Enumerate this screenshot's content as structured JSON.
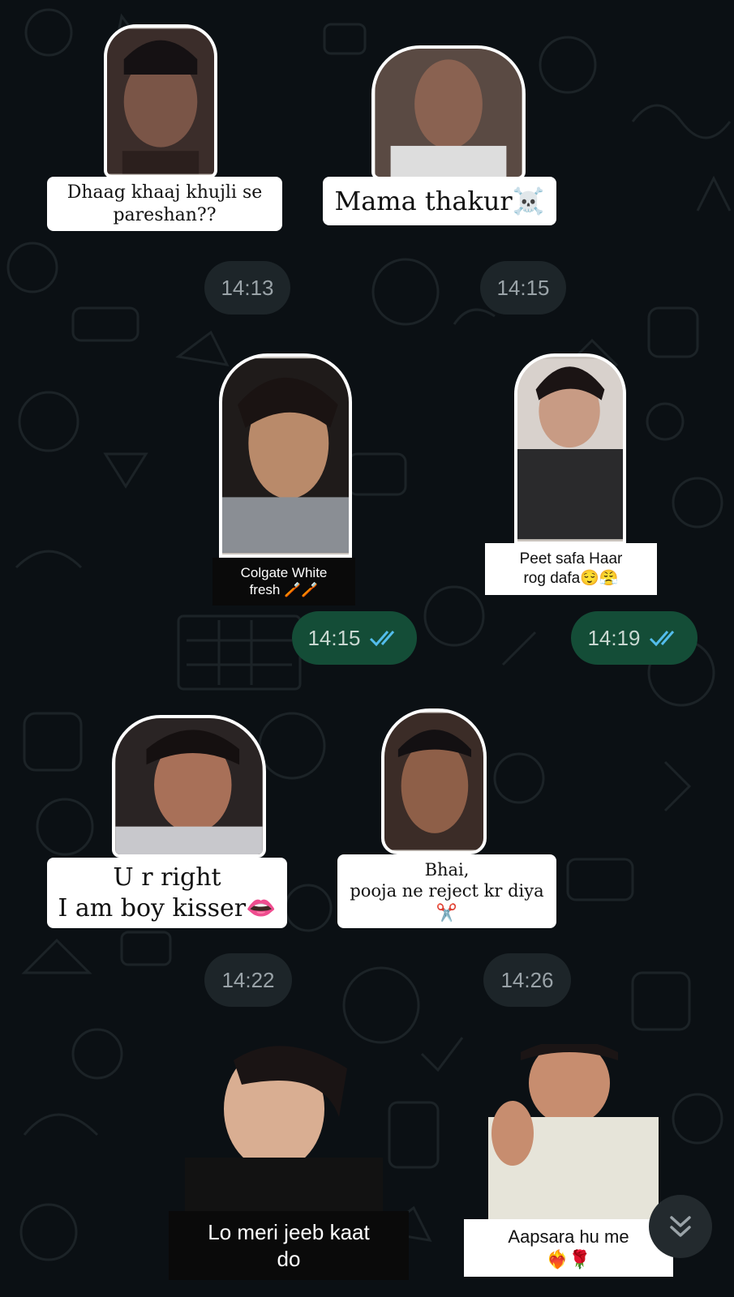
{
  "stickers": [
    {
      "caption": "Dhaag khaaj khujli se\npareshan??"
    },
    {
      "caption": "Mama thakur☠️"
    },
    {
      "caption": "Colgate White\nfresh 🪥🪥"
    },
    {
      "caption": "Peet safa Haar\nrog dafa😌😤"
    },
    {
      "caption": "U r right\nI am boy kisser👄"
    },
    {
      "caption": "Bhai,\npooja ne reject kr diya\n✂️"
    },
    {
      "caption": "Lo meri jeeb kaat\ndo"
    },
    {
      "caption": "Aapsara hu me\n❤️‍🔥🌹"
    }
  ],
  "timestamps": {
    "t1": "14:13",
    "t2": "14:15",
    "t3": "14:15",
    "t4": "14:19",
    "t5": "14:22",
    "t6": "14:26"
  },
  "colors": {
    "background": "#0b1014",
    "received_time_bubble": "#1d2529",
    "sent_time_bubble": "#144d37",
    "read_ticks": "#53bdeb"
  },
  "icons": {
    "read_receipt": "double-check-icon",
    "scroll_down": "double-chevron-down-icon"
  }
}
